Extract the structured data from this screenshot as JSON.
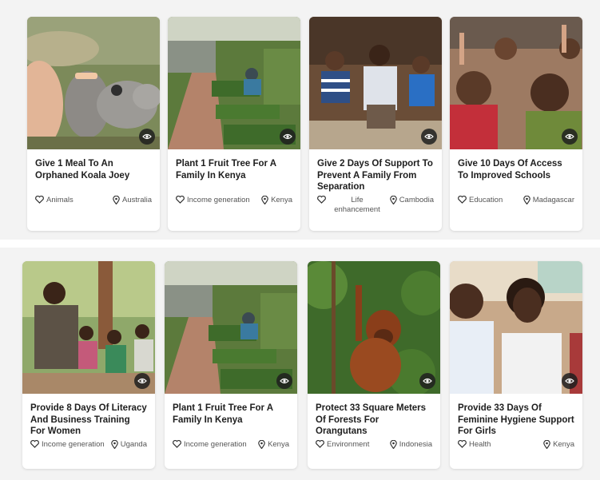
{
  "cards": [
    {
      "title": "Give 1 Meal To An Orphaned Koala Joey",
      "category": "Animals",
      "location": "Australia"
    },
    {
      "title": "Plant 1 Fruit Tree For A Family In Kenya",
      "category": "Income generation",
      "location": "Kenya"
    },
    {
      "title": "Give 2 Days Of Support To Prevent A Family From Separation",
      "category": "Life enhancement",
      "location": "Cambodia"
    },
    {
      "title": "Give 10 Days Of Access To Improved Schools",
      "category": "Education",
      "location": "Madagascar"
    },
    {
      "title": "Provide 8 Days Of Literacy And Business Training For Women",
      "category": "Income generation",
      "location": "Uganda"
    },
    {
      "title": "Plant 1 Fruit Tree For A Family In Kenya",
      "category": "Income generation",
      "location": "Kenya"
    },
    {
      "title": "Protect 33 Square Meters Of Forests For Orangutans",
      "category": "Environment",
      "location": "Indonesia"
    },
    {
      "title": "Provide 33 Days Of Feminine Hygiene Support For Girls",
      "category": "Health",
      "location": "Kenya"
    }
  ],
  "icons": {
    "category": "heart-icon",
    "location": "map-pin-icon",
    "view": "eye-icon"
  }
}
